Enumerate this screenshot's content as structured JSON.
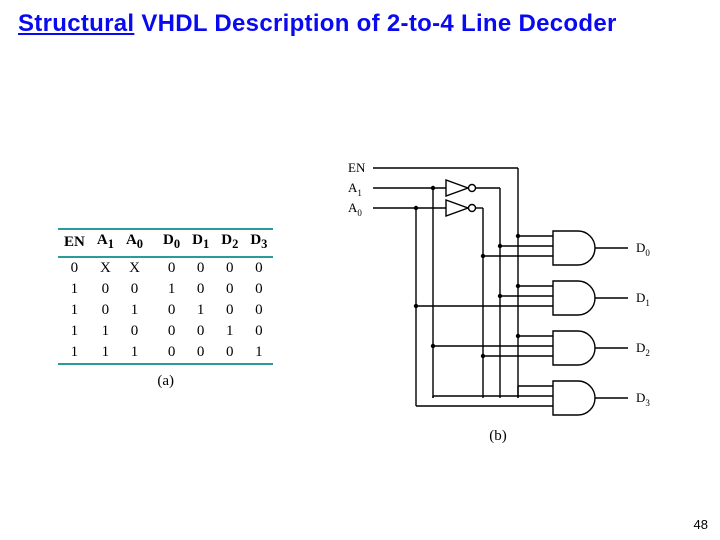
{
  "title_underlined": "Structural",
  "title_rest": " VHDL Description of 2-to-4 Line Decoder",
  "page_number": "48",
  "caption_a": "(a)",
  "caption_b": "(b)",
  "signals": {
    "en": "EN",
    "a1": "A",
    "a1_sub": "1",
    "a0": "A",
    "a0_sub": "0"
  },
  "outputs": {
    "d0": "D",
    "d0_sub": "0",
    "d1": "D",
    "d1_sub": "1",
    "d2": "D",
    "d2_sub": "2",
    "d3": "D",
    "d3_sub": "3"
  },
  "truth_table": {
    "headers": [
      "EN",
      "A1",
      "A0",
      "D0",
      "D1",
      "D2",
      "D3"
    ],
    "header_subs": [
      "",
      "1",
      "0",
      "0",
      "1",
      "2",
      "3"
    ],
    "header_bases": [
      "EN",
      "A",
      "A",
      "D",
      "D",
      "D",
      "D"
    ],
    "rows": [
      [
        "0",
        "X",
        "X",
        "0",
        "0",
        "0",
        "0"
      ],
      [
        "1",
        "0",
        "0",
        "1",
        "0",
        "0",
        "0"
      ],
      [
        "1",
        "0",
        "1",
        "0",
        "1",
        "0",
        "0"
      ],
      [
        "1",
        "1",
        "0",
        "0",
        "0",
        "1",
        "0"
      ],
      [
        "1",
        "1",
        "1",
        "0",
        "0",
        "0",
        "1"
      ]
    ]
  }
}
